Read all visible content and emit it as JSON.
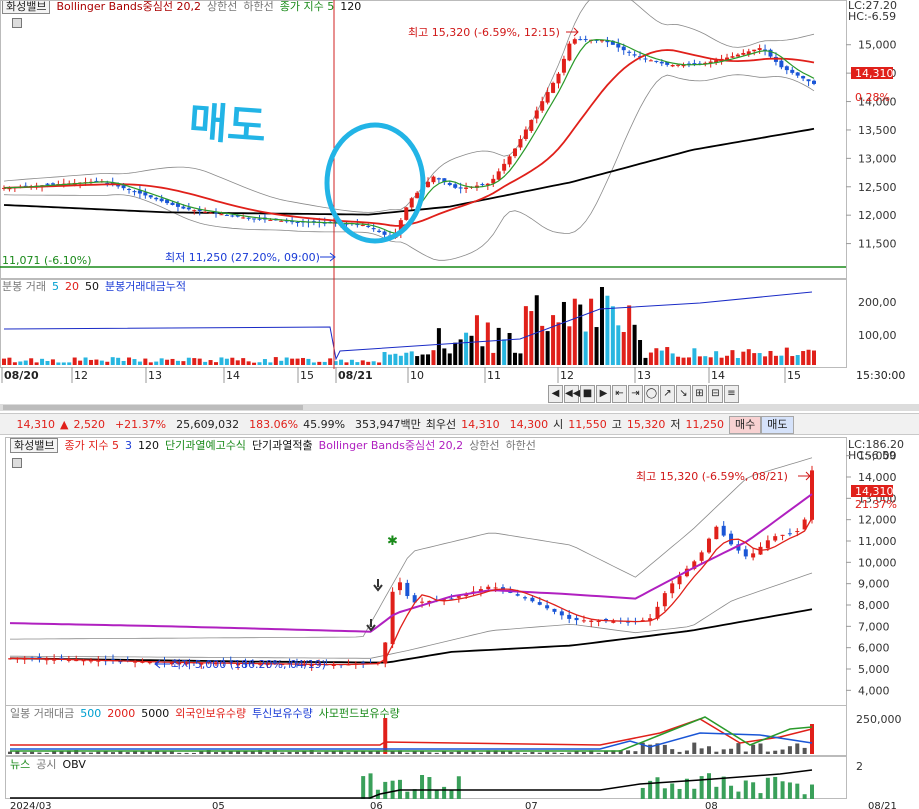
{
  "top_chart": {
    "legend": {
      "stock_name": "화성밸브",
      "bb_mid": "Bollinger Bands중심선 20,2",
      "bb_upper": "상한선",
      "bb_lower": "하한선",
      "ma_title": "종가 지수 5",
      "ma_long": "120"
    },
    "lc": "LC:27.20",
    "hc": "HC:-6.59",
    "price_ticks": [
      "15,000",
      "14,500",
      "14,000",
      "13,500",
      "13,000",
      "12,500",
      "12,000",
      "11,500"
    ],
    "current_price": "14,310",
    "current_pct": "0.28%",
    "high_label": "최고 15,320 (-6.59%, 12:15)",
    "low_label": "최저 11,250 (27.20%, 09:00)",
    "left_label": "11,071 (-6.10%)",
    "handwriting": "매도",
    "volume_legend": {
      "title": "분봉 거래",
      "ma1": "5",
      "ma2": "20",
      "ma3": "50",
      "cum": "분봉거래대금누적"
    },
    "volume_ticks": [
      "200,00",
      "100,00"
    ],
    "time_labels": [
      "08/20",
      "12",
      "13",
      "14",
      "15",
      "08/21",
      "10",
      "11",
      "12",
      "13",
      "14",
      "15"
    ],
    "time_right": "15:30:00",
    "chart_data": {
      "type": "candlestick",
      "interval": "minute",
      "ylim": [
        11000,
        15400
      ],
      "yticks": [
        11500,
        12000,
        12500,
        13000,
        13500,
        14000,
        14500,
        15000
      ],
      "high": 15320,
      "low": 11250,
      "last": 14310,
      "series": [
        "Bollinger upper",
        "Bollinger middle 20",
        "Bollinger lower",
        "MA5",
        "MA120"
      ],
      "colors": {
        "up": "#e0201a",
        "down": "#1a56d6",
        "ma5": "#2a9a2a",
        "bb_mid": "#e0201a",
        "ma120": "#000000",
        "bb_band": "#808080"
      }
    }
  },
  "controls": {
    "buttons": [
      "◀",
      "◀◀",
      "■",
      "▶",
      "⇤",
      "⇥",
      "◯",
      "↗",
      "↘",
      "⊞",
      "⊟",
      "≡"
    ]
  },
  "info_bar": {
    "price": "14,310",
    "arrow": "▲",
    "change": "2,520",
    "change_pct": "+21.37%",
    "volume": "25,609,032",
    "volume_ratio": "183.06%",
    "turnover": "45.99%",
    "amount": "353,947백만",
    "bid_label": "최우선",
    "bid": "14,310",
    "ask": "14,300",
    "open_label": "시",
    "open": "11,550",
    "high_label": "고",
    "high": "15,320",
    "low_label": "저",
    "low": "11,250",
    "buy_button": "매수",
    "sell_button": "매도"
  },
  "bottom_chart": {
    "legend": {
      "stock_name": "화성밸브",
      "ma_title": "종가 지수 5",
      "ma_mid": "3",
      "ma_long": "120",
      "short_cross": "단기과열예고수식",
      "short_hot": "단기과열적출",
      "bb_mid": "Bollinger Bands중심선 20,2",
      "bb_upper": "상한선",
      "bb_lower": "하한선"
    },
    "lc": "LC:186.20",
    "hc": "HC:-6.59",
    "price_ticks": [
      "15,000",
      "14,000",
      "13,000",
      "12,000",
      "11,000",
      "10,000",
      "9,000",
      "8,000",
      "7,000",
      "6,000",
      "5,000",
      "4,000"
    ],
    "current_price": "14,310",
    "current_pct": "21.37%",
    "high_label": "최고 15,320 (-6.59%, 08/21)",
    "low_label": "최저 5,000 (186.20%, 04/19)",
    "volume_legend": {
      "title": "일봉 거래대금",
      "ma1": "500",
      "ma2": "2000",
      "ma3": "5000",
      "foreign": "외국인보유수량",
      "trust": "투신보유수량",
      "private": "사모펀드보유수량"
    },
    "volume_ticks": [
      "250,000"
    ],
    "obv_legend": {
      "news": "뉴스",
      "disclosure": "공시",
      "obv": "OBV"
    },
    "obv_ticks": [
      "2"
    ],
    "time_labels": [
      "2024/03",
      "05",
      "06",
      "07",
      "08",
      "08/21"
    ],
    "chart_data": {
      "type": "candlestick",
      "interval": "day",
      "ylim": [
        3500,
        15500
      ],
      "yticks": [
        4000,
        5000,
        6000,
        7000,
        8000,
        9000,
        10000,
        11000,
        12000,
        13000,
        14000,
        15000
      ],
      "high": 15320,
      "low": 5000,
      "last": 14310,
      "series": [
        "MA5",
        "MA120",
        "Bollinger upper",
        "Bollinger middle 20",
        "Bollinger lower"
      ],
      "colors": {
        "up": "#e0201a",
        "down": "#1a56d6",
        "bb_mid": "#b020c0",
        "ma120": "#000000",
        "bb_band": "#808080"
      }
    }
  }
}
